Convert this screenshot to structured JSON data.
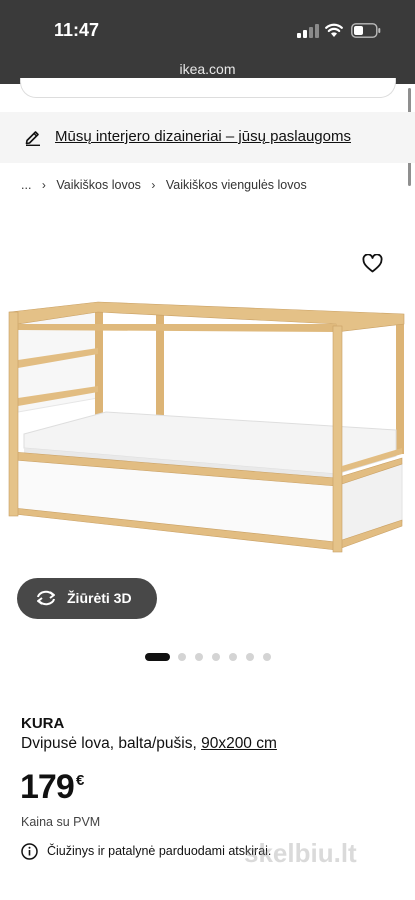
{
  "status_bar": {
    "time": "11:47"
  },
  "browser": {
    "url": "ikea.com"
  },
  "banner": {
    "link_text": "Mūsų interjero dizaineriai – jūsų paslaugoms"
  },
  "breadcrumb": {
    "items": [
      "...",
      "Vaikiškos lovos",
      "Vaikiškos viengulės lovos"
    ]
  },
  "gallery": {
    "view_3d_label": "Žiūrėti 3D",
    "slide_count": 7,
    "active_slide": 1
  },
  "product": {
    "name": "KURA",
    "description": "Dvipusė lova, balta/pušis, ",
    "size": "90x200 cm",
    "price": "179",
    "currency": "€",
    "price_note": "Kaina su PVM",
    "notice": "Čiužinys ir patalynė parduodami atskirai."
  },
  "watermark": "skelbiu.lt",
  "colors": {
    "status_bar_bg": "#3a3a3a",
    "banner_bg": "#f5f5f5",
    "button_bg": "#484848",
    "wood": "#e2bd82"
  }
}
